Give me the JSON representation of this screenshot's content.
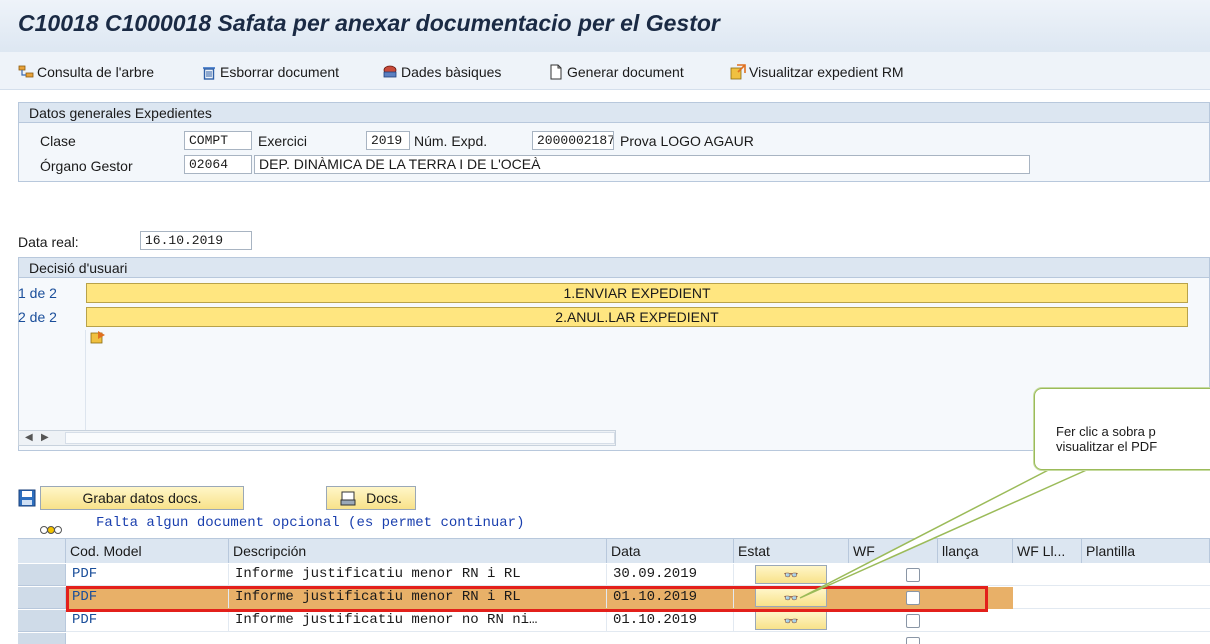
{
  "window": {
    "title": "C10018 C1000018 Safata per anexar documentacio per el Gestor"
  },
  "toolbar": {
    "consulta": "Consulta de l'arbre",
    "esborrar": "Esborrar document",
    "dades": "Dades bàsiques",
    "generar": "Generar document",
    "visualitzar": "Visualitzar expedient RM"
  },
  "general": {
    "title": "Datos generales Expedientes",
    "clase_label": "Clase",
    "clase_value": "COMPT",
    "exercici_label": "Exercici",
    "exercici_value": "2019",
    "num_label": "Núm. Expd.",
    "num_value": "2000002187",
    "num_desc": "Prova LOGO AGAUR",
    "organo_label": "Órgano Gestor",
    "organo_value": "02064",
    "organo_desc": "DEP. DINÀMICA DE LA TERRA I DE L'OCEÀ"
  },
  "data_real": {
    "label": "Data real:",
    "value": "16.10.2019"
  },
  "decisio": {
    "title": "Decisió d'usuari",
    "rows": [
      {
        "index": "1 de 2",
        "label": "1.ENVIAR EXPEDIENT"
      },
      {
        "index": "2 de 2",
        "label": "2.ANUL.LAR EXPEDIENT"
      }
    ]
  },
  "actions": {
    "grabar": "Grabar datos docs.",
    "docs": "Docs."
  },
  "status_message": "Falta algun document opcional (es permet continuar)",
  "table": {
    "headers": [
      "Cod. Model",
      "Descripción",
      "Data",
      "Estat",
      "WF",
      "llança",
      "WF Ll...",
      "Plantilla"
    ],
    "rows": [
      {
        "cod": "PDF",
        "desc": "Informe justificatiu menor RN i RL",
        "data": "30.09.2019"
      },
      {
        "cod": "PDF",
        "desc": "Informe justificatiu menor RN i RL",
        "data": "01.10.2019"
      },
      {
        "cod": "PDF",
        "desc": "Informe justificatiu menor no RN ni…",
        "data": "01.10.2019"
      }
    ]
  },
  "callout": {
    "text": "Fer clic a sobra p visualitzar el PDF"
  },
  "colors": {
    "highlight_row": "#e8b068",
    "highlight_border": "#e3201b",
    "button_yellow": "#ffe680",
    "callout_border": "#9bbb59"
  },
  "icons": [
    "tree-icon",
    "trash-icon",
    "basic-data-icon",
    "document-icon",
    "expedient-icon",
    "save-icon",
    "docs-icon",
    "traffic-light-icon",
    "display-icon",
    "arrow-folder-icon"
  ]
}
